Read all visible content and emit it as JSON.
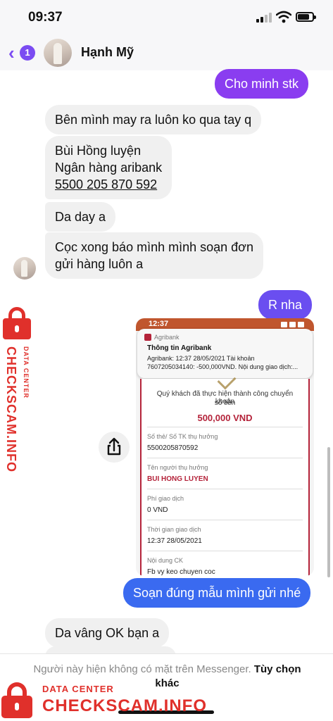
{
  "status_bar": {
    "time": "09:37"
  },
  "header": {
    "unread_count": "1",
    "contact_name": "Hạnh Mỹ"
  },
  "colors": {
    "accent": "#7b4cf2",
    "out_bubble_top": "#8a3df0",
    "out_bubble_bottom": "#3a6af0",
    "incoming": "#f0f0f0",
    "watermark": "#e0302b"
  },
  "messages": [
    {
      "direction": "out",
      "text": "Cho minh stk"
    },
    {
      "direction": "in",
      "text": "Bên mình may ra luôn ko qua tay q"
    },
    {
      "direction": "in",
      "lines": [
        "Bùi Hồng luyện",
        "Ngân hàng aribank",
        "5500 205 870 592"
      ]
    },
    {
      "direction": "in",
      "text": "Da day a"
    },
    {
      "direction": "in",
      "lines": [
        "Cọc xong báo mình mình soạn đơn",
        "gửi hàng luôn a"
      ]
    },
    {
      "direction": "out",
      "text": "R nha"
    },
    {
      "direction": "out",
      "text": "Soạn đúng mẫu mình gửi nhé"
    },
    {
      "direction": "in",
      "text": "Da vâng OK bạn a"
    }
  ],
  "screenshot": {
    "status_time": "12:37",
    "app_name": "Agribank",
    "notif_title": "Thông tin Agribank",
    "notif_line1": "Agribank: 12:37 28/05/2021 Tài khoản",
    "notif_line2": "7607205034140: -500,000VND. Nội dung giao dịch:...",
    "success_line1": "Quý khách đã thực hiện thành công chuyển khoản",
    "success_line2": "số tiền",
    "amount": "500,000 VND",
    "fields": [
      {
        "label": "Số thẻ/ Số TK thụ hưởng",
        "value": "5500205870592"
      },
      {
        "label": "Tên người thụ hưởng",
        "value": "BUI HONG LUYEN"
      },
      {
        "label": "Phí giao dịch",
        "value": "0 VND"
      },
      {
        "label": "Thời gian giao dịch",
        "value": "12:37 28/05/2021"
      },
      {
        "label": "Nội dung CK",
        "value": "Fb vy keo chuyen coc"
      }
    ]
  },
  "footer": {
    "notice": "Người này hiện không có mặt trên Messenger.",
    "link": "Tùy chọn khác"
  },
  "watermark": {
    "line1": "DATA CENTER",
    "line2": "CHECKSCAM.INFO"
  }
}
